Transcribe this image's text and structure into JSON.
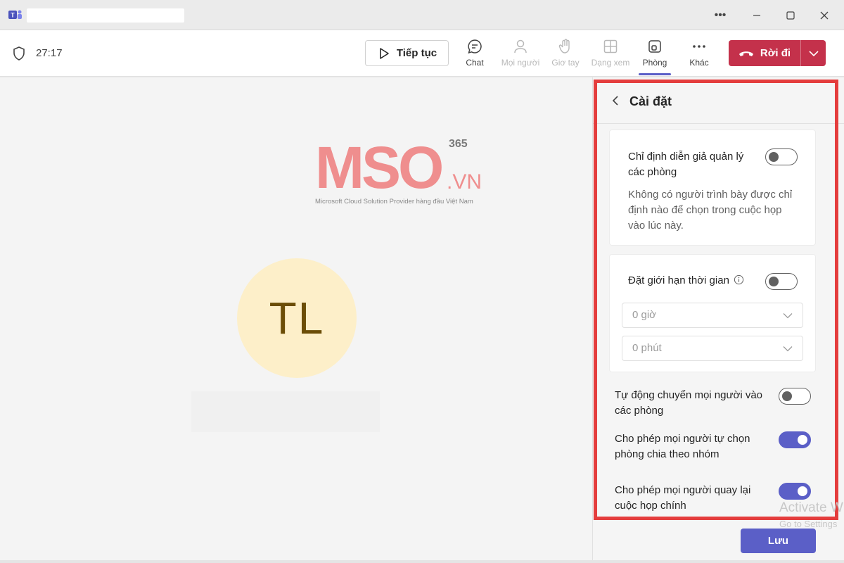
{
  "window": {
    "title": ""
  },
  "toolbar": {
    "timer": "27:17",
    "resume_label": "Tiếp tục",
    "tools": [
      {
        "label": "Chat",
        "state": "normal"
      },
      {
        "label": "Mọi người",
        "state": "disabled"
      },
      {
        "label": "Giơ tay",
        "state": "disabled"
      },
      {
        "label": "Dạng xem",
        "state": "disabled"
      },
      {
        "label": "Phòng",
        "state": "active"
      },
      {
        "label": "Khác",
        "state": "normal"
      }
    ],
    "leave_label": "Rời đi"
  },
  "stage": {
    "avatar_initials": "TL",
    "watermark": {
      "brand": "MSO",
      "superscript": "365",
      "suffix": ".VN",
      "tagline": "Microsoft Cloud Solution Provider hàng đầu Việt Nam"
    }
  },
  "settings": {
    "title": "Cài đặt",
    "assign_presenters": {
      "label_line1": "Chỉ định diễn giả quản lý",
      "label_line2": "các phòng",
      "enabled": false,
      "description": "Không có người trình bày được chỉ định nào để chọn trong cuộc họp vào lúc này."
    },
    "time_limit": {
      "label": "Đặt giới hạn thời gian",
      "enabled": false,
      "hours_value": "0 giờ",
      "minutes_value": "0 phút"
    },
    "auto_move": {
      "label_line1": "Tự động chuyển mọi người vào",
      "label_line2": "các phòng",
      "enabled": false
    },
    "choose_room": {
      "label_line1": "Cho phép mọi người tự chọn",
      "label_line2": "phòng chia theo nhóm",
      "enabled": true
    },
    "return_main": {
      "label_line1": "Cho phép mọi người quay lại",
      "label_line2": "cuộc họp chính",
      "enabled": true
    },
    "save_label": "Lưu"
  },
  "os_overlay": {
    "activate_line1": "Activate W",
    "activate_line2": "Go to Settings"
  },
  "colors": {
    "accent": "#5b5fc7",
    "leave": "#c4314b",
    "highlight_frame": "#e43d3d",
    "avatar_bg": "#fdefc9",
    "avatar_text": "#6b4d07"
  }
}
